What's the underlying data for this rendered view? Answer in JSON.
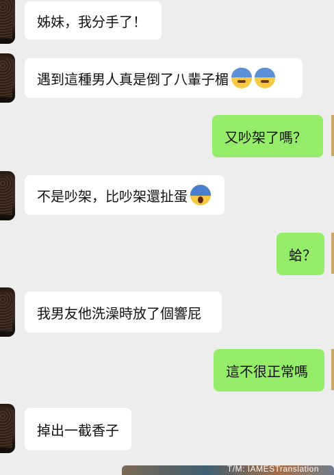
{
  "messages": [
    {
      "side": "received",
      "text": "姊妹，我分手了！"
    },
    {
      "side": "received",
      "text": "遇到這種男人真是倒了八輩子楣",
      "emoji": [
        "sweat-face-icon",
        "sweat-face-icon"
      ]
    },
    {
      "side": "sent",
      "text": "又吵架了嗎？"
    },
    {
      "side": "received",
      "text": "不是吵架，比吵架還扯蛋",
      "emoji": [
        "screaming-face-icon"
      ]
    },
    {
      "side": "sent",
      "text": "蛤？"
    },
    {
      "side": "received",
      "text": "我男友他洗澡時放了個響屁"
    },
    {
      "side": "sent",
      "text": "這不很正常嗎"
    },
    {
      "side": "received",
      "text": "掉出一截香子"
    }
  ],
  "watermark": "T/M: IAMESTranslation",
  "colors": {
    "background": "#ededed",
    "received_bubble": "#ffffff",
    "sent_bubble": "#95ec69"
  }
}
